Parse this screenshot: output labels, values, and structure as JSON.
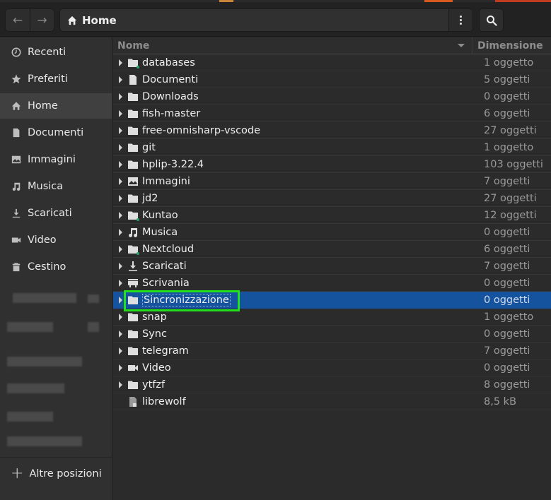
{
  "header": {
    "back_label": "←",
    "forward_label": "→",
    "path_label": "Home",
    "menu_icon": "kebab-menu-icon",
    "search_icon": "search-icon"
  },
  "sidebar": {
    "items": [
      {
        "label": "Recenti",
        "icon": "clock-icon"
      },
      {
        "label": "Preferiti",
        "icon": "star-icon"
      },
      {
        "label": "Home",
        "icon": "home-icon",
        "active": true
      },
      {
        "label": "Documenti",
        "icon": "document-icon"
      },
      {
        "label": "Immagini",
        "icon": "image-icon"
      },
      {
        "label": "Musica",
        "icon": "music-icon"
      },
      {
        "label": "Scaricati",
        "icon": "download-icon"
      },
      {
        "label": "Video",
        "icon": "video-icon"
      },
      {
        "label": "Cestino",
        "icon": "trash-icon"
      }
    ],
    "other_locations": "Altre posizioni"
  },
  "list": {
    "columns": {
      "name": "Nome",
      "size": "Dimensione"
    },
    "rows": [
      {
        "name": "databases",
        "size": "1 oggetto",
        "icon": "folder-icon",
        "emblem": true
      },
      {
        "name": "Documenti",
        "size": "5 oggetti",
        "icon": "document-icon"
      },
      {
        "name": "Downloads",
        "size": "0 oggetti",
        "icon": "folder-icon"
      },
      {
        "name": "fish-master",
        "size": "6 oggetti",
        "icon": "folder-icon"
      },
      {
        "name": "free-omnisharp-vscode",
        "size": "27 oggetti",
        "icon": "folder-icon"
      },
      {
        "name": "git",
        "size": "1 oggetto",
        "icon": "folder-icon"
      },
      {
        "name": "hplip-3.22.4",
        "size": "103 oggetti",
        "icon": "folder-icon"
      },
      {
        "name": "Immagini",
        "size": "7 oggetti",
        "icon": "image-icon"
      },
      {
        "name": "jd2",
        "size": "27 oggetti",
        "icon": "folder-icon"
      },
      {
        "name": "Kuntao",
        "size": "12 oggetti",
        "icon": "folder-icon",
        "emblem": true
      },
      {
        "name": "Musica",
        "size": "0 oggetti",
        "icon": "music-icon"
      },
      {
        "name": "Nextcloud",
        "size": "6 oggetti",
        "icon": "folder-icon",
        "emblem": true
      },
      {
        "name": "Scaricati",
        "size": "7 oggetti",
        "icon": "download-icon"
      },
      {
        "name": "Scrivania",
        "size": "0 oggetti",
        "icon": "desktop-icon"
      },
      {
        "name": "Sincronizzazione",
        "size": "0 oggetti",
        "icon": "folder-icon",
        "selected": true
      },
      {
        "name": "snap",
        "size": "1 oggetto",
        "icon": "folder-icon"
      },
      {
        "name": "Sync",
        "size": "0 oggetti",
        "icon": "folder-icon"
      },
      {
        "name": "telegram",
        "size": "7 oggetti",
        "icon": "folder-icon"
      },
      {
        "name": "Video",
        "size": "0 oggetti",
        "icon": "video-icon"
      },
      {
        "name": "ytfzf",
        "size": "8 oggetti",
        "icon": "folder-icon"
      },
      {
        "name": "librewolf",
        "size": "8,5  kB",
        "icon": "executable-icon",
        "file": true
      }
    ]
  },
  "colors": {
    "selection": "#15539e",
    "highlight_box": "#22e01c",
    "emblem": "#26a269"
  }
}
